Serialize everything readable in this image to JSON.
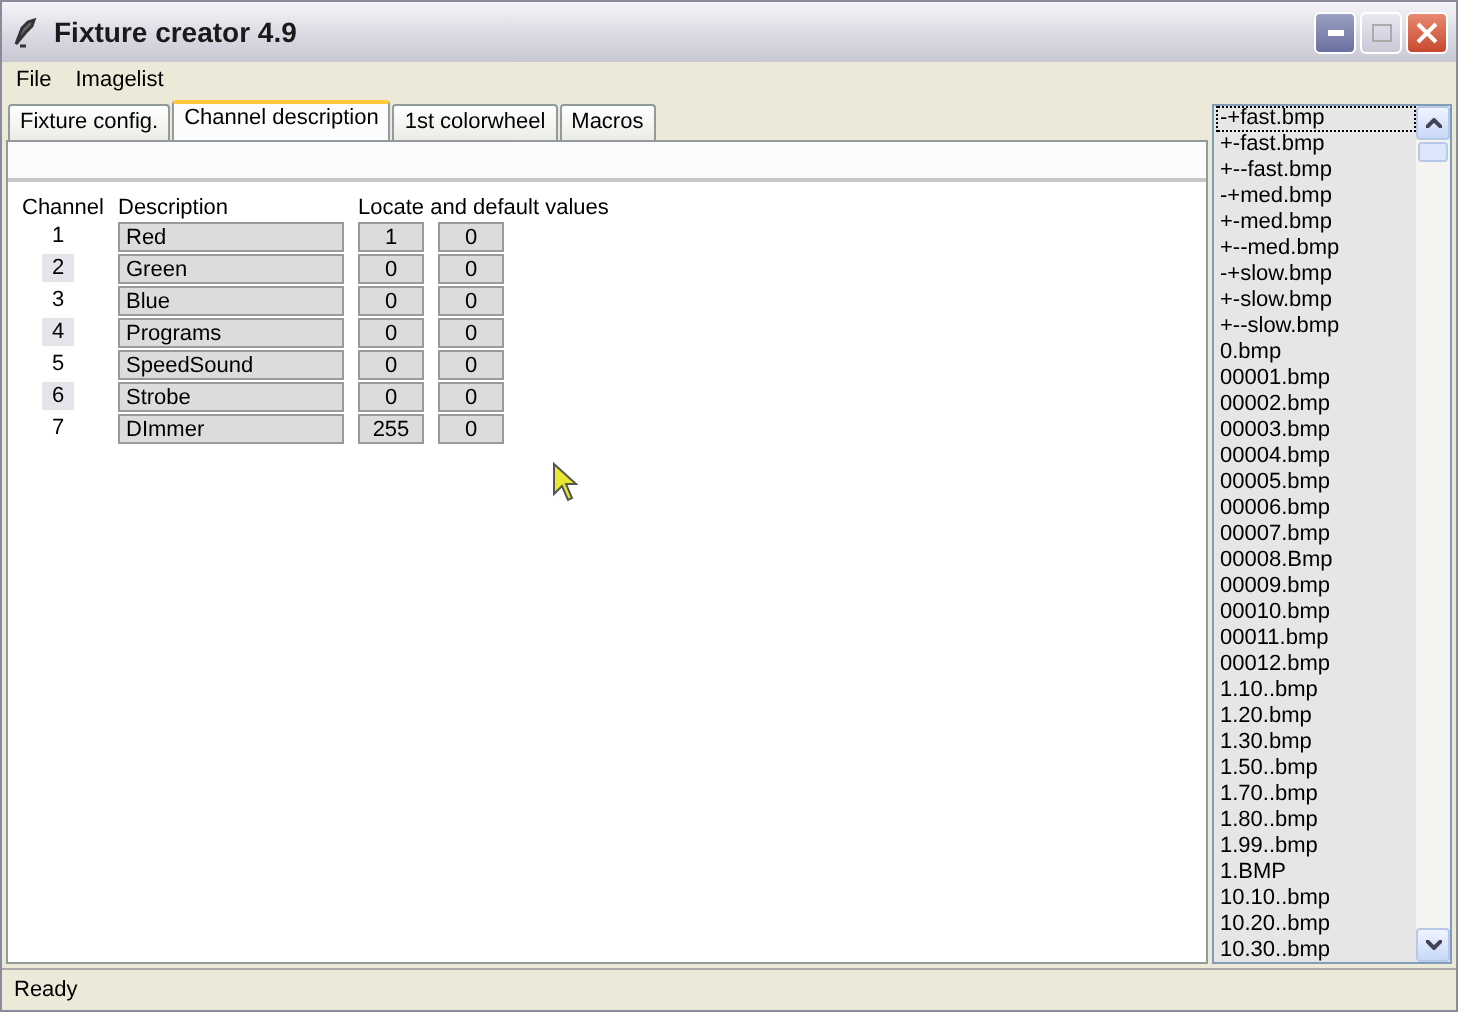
{
  "window": {
    "title": "Fixture creator 4.9"
  },
  "menu": [
    "File",
    "Imagelist"
  ],
  "tabs": [
    {
      "label": "Fixture config.",
      "selected": false
    },
    {
      "label": "Channel description",
      "selected": true
    },
    {
      "label": "1st colorwheel",
      "selected": false
    },
    {
      "label": "Macros",
      "selected": false
    }
  ],
  "headers": {
    "channel": "Channel",
    "description": "Description",
    "values": "Locate and default values"
  },
  "channels": [
    {
      "number": "1",
      "shaded": false,
      "description": "Red",
      "locate": "1",
      "default": "0"
    },
    {
      "number": "2",
      "shaded": true,
      "description": "Green",
      "locate": "0",
      "default": "0"
    },
    {
      "number": "3",
      "shaded": false,
      "description": "Blue",
      "locate": "0",
      "default": "0"
    },
    {
      "number": "4",
      "shaded": true,
      "description": "Programs",
      "locate": "0",
      "default": "0"
    },
    {
      "number": "5",
      "shaded": false,
      "description": "SpeedSound",
      "locate": "0",
      "default": "0"
    },
    {
      "number": "6",
      "shaded": true,
      "description": "Strobe",
      "locate": "0",
      "default": "0"
    },
    {
      "number": "7",
      "shaded": false,
      "description": "DImmer",
      "locate": "255",
      "default": "0"
    }
  ],
  "imagelist": [
    {
      "name": "-+fast.bmp",
      "focused": true
    },
    {
      "name": "+-fast.bmp",
      "focused": false
    },
    {
      "name": "+--fast.bmp",
      "focused": false
    },
    {
      "name": "-+med.bmp",
      "focused": false
    },
    {
      "name": "+-med.bmp",
      "focused": false
    },
    {
      "name": "+--med.bmp",
      "focused": false
    },
    {
      "name": "-+slow.bmp",
      "focused": false
    },
    {
      "name": "+-slow.bmp",
      "focused": false
    },
    {
      "name": "+--slow.bmp",
      "focused": false
    },
    {
      "name": "0.bmp",
      "focused": false
    },
    {
      "name": "00001.bmp",
      "focused": false
    },
    {
      "name": "00002.bmp",
      "focused": false
    },
    {
      "name": "00003.bmp",
      "focused": false
    },
    {
      "name": "00004.bmp",
      "focused": false
    },
    {
      "name": "00005.bmp",
      "focused": false
    },
    {
      "name": "00006.bmp",
      "focused": false
    },
    {
      "name": "00007.bmp",
      "focused": false
    },
    {
      "name": "00008.Bmp",
      "focused": false
    },
    {
      "name": "00009.bmp",
      "focused": false
    },
    {
      "name": "00010.bmp",
      "focused": false
    },
    {
      "name": "00011.bmp",
      "focused": false
    },
    {
      "name": "00012.bmp",
      "focused": false
    },
    {
      "name": "1.10..bmp",
      "focused": false
    },
    {
      "name": "1.20.bmp",
      "focused": false
    },
    {
      "name": "1.30.bmp",
      "focused": false
    },
    {
      "name": "1.50..bmp",
      "focused": false
    },
    {
      "name": "1.70..bmp",
      "focused": false
    },
    {
      "name": "1.80..bmp",
      "focused": false
    },
    {
      "name": "1.99..bmp",
      "focused": false
    },
    {
      "name": "1.BMP",
      "focused": false
    },
    {
      "name": "10.10..bmp",
      "focused": false
    },
    {
      "name": "10.20..bmp",
      "focused": false
    },
    {
      "name": "10.30..bmp",
      "focused": false
    }
  ],
  "status_bar": "Ready"
}
